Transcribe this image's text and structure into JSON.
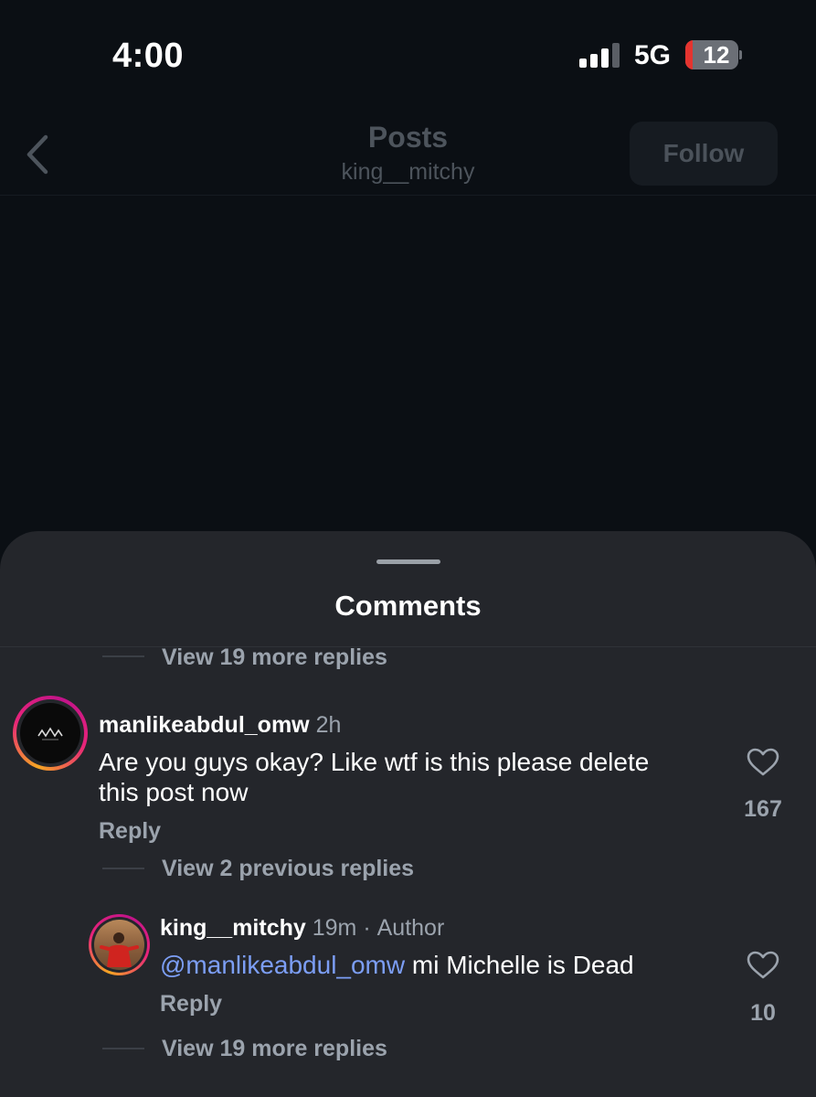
{
  "status_bar": {
    "time": "4:00",
    "network": "5G",
    "battery_level": "12",
    "battery_color": "#e5342f"
  },
  "header": {
    "back_icon": "chevron-left-icon",
    "title": "Posts",
    "username": "king__mitchy",
    "follow_label": "Follow"
  },
  "comments_sheet": {
    "title": "Comments",
    "top_view_more": "View 19 more replies",
    "comments": [
      {
        "username": "manlikeabdul_omw",
        "time": "2h",
        "text": "Are you guys okay? Like wtf is this please delete this post now",
        "reply_label": "Reply",
        "likes": "167",
        "view_previous": "View 2 previous replies"
      }
    ],
    "replies": [
      {
        "username": "king__mitchy",
        "time": "19m",
        "author_label": "Author",
        "mention": "@manlikeabdul_omw",
        "text": " mi Michelle is Dead",
        "reply_label": "Reply",
        "likes": "10",
        "view_more": "View 19 more replies"
      }
    ]
  }
}
